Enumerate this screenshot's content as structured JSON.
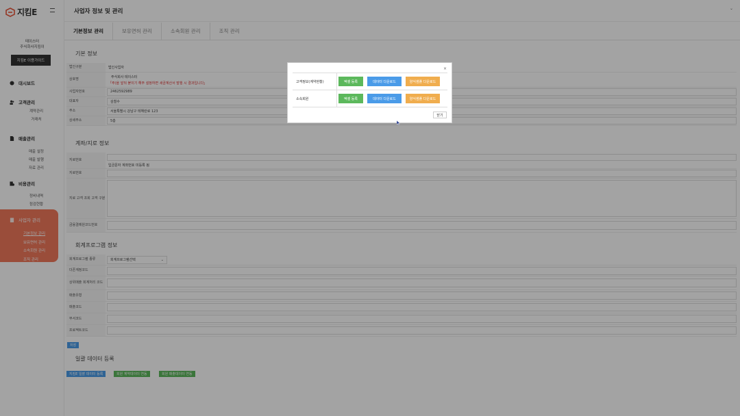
{
  "brand": {
    "name": "지킴E",
    "accent": "#f1795c"
  },
  "sidebar": {
    "user_line1": "테이스터",
    "user_line2": "주식회사지킴이",
    "guide_button": "지킴E 이용가이드",
    "groups": [
      {
        "title": "대시보드",
        "items": []
      },
      {
        "title": "고객관리",
        "items": [
          "계약관리",
          "거래처"
        ]
      },
      {
        "title": "매출관리",
        "items": [
          "매출 설정",
          "매출 발행",
          "자료 관리"
        ]
      },
      {
        "title": "비용관리",
        "items": [
          "정비내역",
          "점검현황"
        ]
      }
    ],
    "active_group": {
      "title": "사업자 관리",
      "items": [
        "기본정보 관리",
        "보유면허 관리",
        "소속회원 관리",
        "조직 관리"
      ]
    }
  },
  "header": {
    "title": "사업자 정보 및 관리"
  },
  "tabs": [
    "기본정보 관리",
    "보유면허 관리",
    "소속회원 관리",
    "조직 관리"
  ],
  "basic": {
    "title": "기본 정보",
    "rows": [
      {
        "label": "법인구분",
        "value": "법인사업자"
      },
      {
        "label": "상호명",
        "value": "주식회사 테이스터",
        "warning": "「주)을 앞뒤 붙이기 해주 설정하면 세금계산서 발행 시 결과입니다」"
      },
      {
        "label": "사업자번호",
        "value": "2462592989"
      },
      {
        "label": "대표자",
        "value": "김철수"
      },
      {
        "label": "주소",
        "value": "서울특별시 강남구 테헤란로 123"
      },
      {
        "label": "상세주소",
        "value": "5층"
      }
    ]
  },
  "account": {
    "title": "계좌/지로 정보",
    "rows": [
      {
        "label": "지로번호",
        "value": ""
      },
      {
        "label": "",
        "value": "입금문자 계좌번호 미등록 됨"
      },
      {
        "label": "지로번호",
        "value": ""
      },
      {
        "label": "지로 고객 조회 고객 구분",
        "value": ""
      },
      {
        "label": "금융결제원코드번호",
        "value": ""
      }
    ]
  },
  "accounting": {
    "title": "회계프로그램 정보",
    "rows": [
      {
        "label": "회계프로그램 종류",
        "value": "회계프로그램선택"
      },
      {
        "label": "더존계정코드",
        "value": ""
      },
      {
        "label": "상위매출 회계처리 코드",
        "value": ""
      },
      {
        "label": "매출유형",
        "value": ""
      },
      {
        "label": "매출코드",
        "value": ""
      },
      {
        "label": "부서코드",
        "value": ""
      },
      {
        "label": "프로젝트코드",
        "value": ""
      }
    ],
    "save_button": "저장"
  },
  "bulk": {
    "title": "일괄 데이터 등록",
    "buttons": [
      "지킴E 일괄 데이터 등록",
      "회원 계약데이터 연동",
      "회원 매출데이터 연동"
    ]
  },
  "modal": {
    "close_icon": "×",
    "rows": [
      {
        "label": "고객정보(계약현황)",
        "actions": [
          "엑셀 등록",
          "데이터 다운로드",
          "양식샘플 다운로드"
        ]
      },
      {
        "label": "소속회원",
        "actions": [
          "엑셀 등록",
          "데이터 다운로드",
          "양식샘플 다운로드"
        ]
      }
    ],
    "close_button": "닫기"
  }
}
